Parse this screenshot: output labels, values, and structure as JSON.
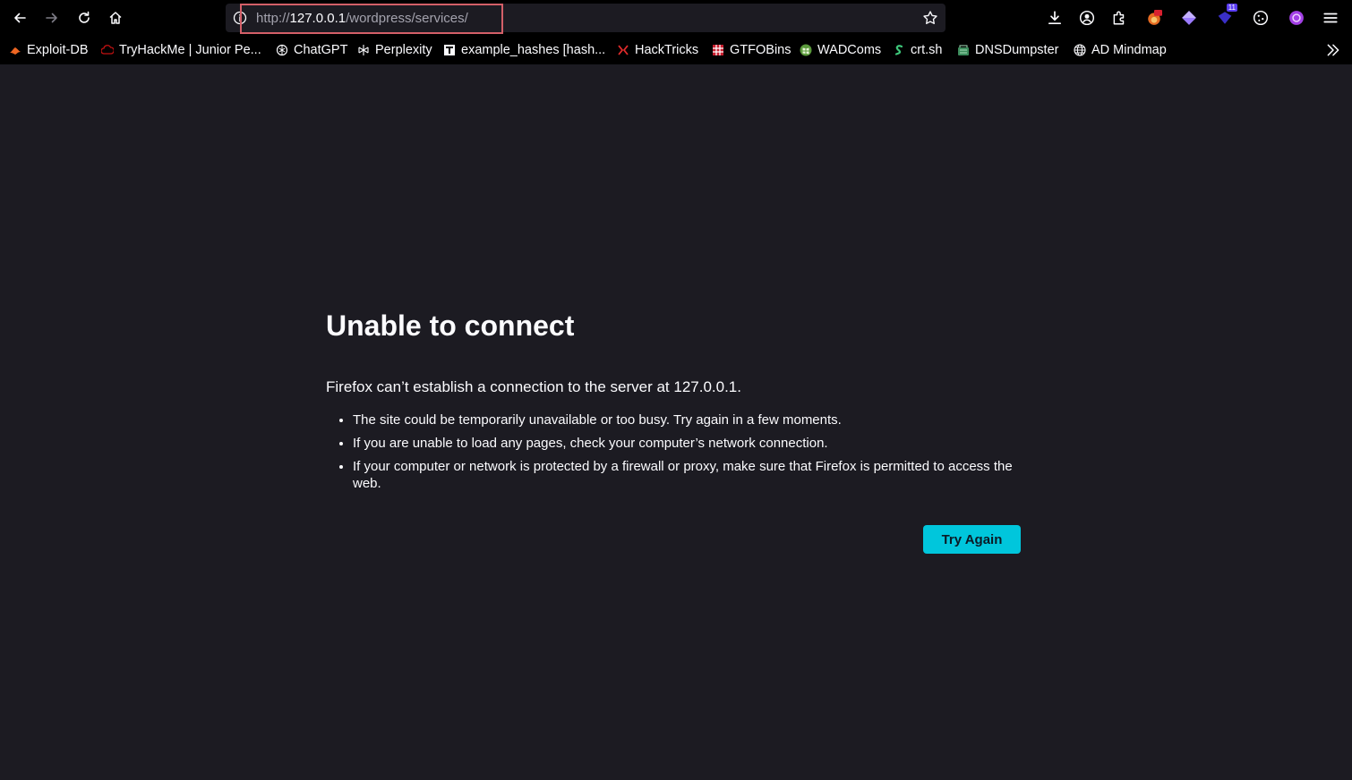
{
  "toolbar": {
    "url": {
      "scheme": "http://",
      "host": "127.0.0.1",
      "path": "/wordpress/services/"
    },
    "notification_badge": "11",
    "icons": [
      "back-icon",
      "forward-icon",
      "reload-icon",
      "home-icon",
      "info-icon",
      "bookmark-star-icon",
      "downloads-icon",
      "account-icon",
      "extensions-icon",
      "foxyproxy-icon",
      "extension-diamond-icon",
      "extension-notifications-icon",
      "cookie-icon",
      "extension-purple-icon",
      "menu-icon"
    ]
  },
  "bookmarks": [
    {
      "label": "Exploit-DB",
      "icon": "exploitdb-icon"
    },
    {
      "label": "TryHackMe | Junior Pe...",
      "icon": "tryhackme-icon"
    },
    {
      "label": "ChatGPT",
      "icon": "chatgpt-icon"
    },
    {
      "label": "Perplexity",
      "icon": "perplexity-icon"
    },
    {
      "label": "example_hashes [hash...",
      "icon": "hashcat-icon"
    },
    {
      "label": "HackTricks",
      "icon": "hacktricks-icon"
    },
    {
      "label": "GTFOBins",
      "icon": "gtfobins-icon"
    },
    {
      "label": "WADComs",
      "icon": "wadcoms-icon"
    },
    {
      "label": "crt.sh",
      "icon": "crtsh-icon"
    },
    {
      "label": "DNSDumpster",
      "icon": "dnsdumpster-icon"
    },
    {
      "label": "AD Mindmap",
      "icon": "globe-icon"
    }
  ],
  "error": {
    "title": "Unable to connect",
    "description": "Firefox can’t establish a connection to the server at 127.0.0.1.",
    "reasons": [
      "The site could be temporarily unavailable or too busy. Try again in a few moments.",
      "If you are unable to load any pages, check your computer’s network connection.",
      "If your computer or network is protected by a firewall or proxy, make sure that Firefox is permitted to access the web."
    ],
    "button_label": "Try Again"
  },
  "colors": {
    "page_background": "#1c1b22",
    "chrome_background": "#000000",
    "button_accent": "#00c6dc",
    "url_highlight": "#d35f68"
  }
}
